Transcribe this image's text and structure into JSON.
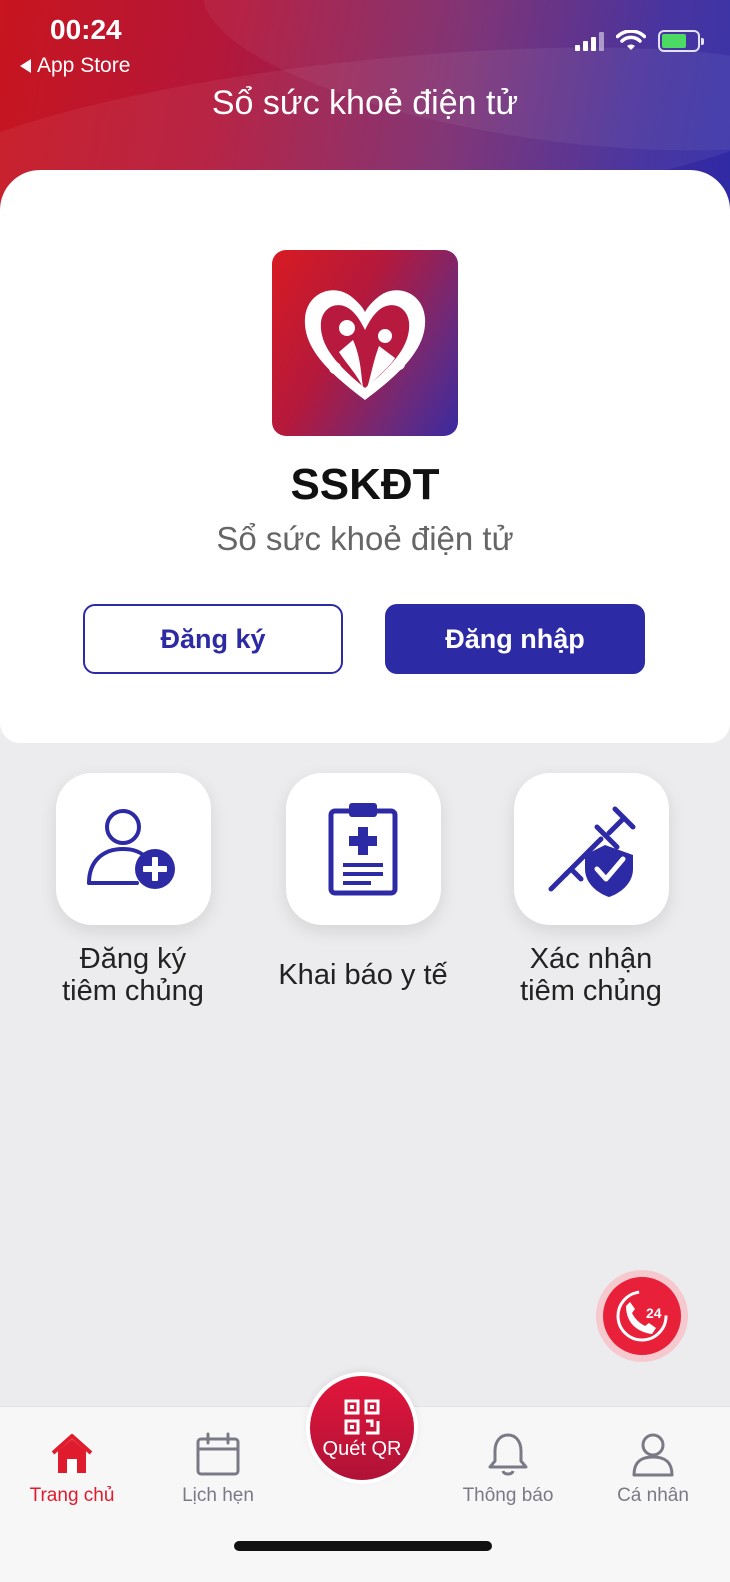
{
  "status_bar": {
    "time": "00:24",
    "back_label": "App Store"
  },
  "header": {
    "title": "Sổ sức khoẻ điện tử"
  },
  "app": {
    "name": "SSKĐT",
    "subtitle": "Sổ sức khoẻ điện tử"
  },
  "auth": {
    "register_label": "Đăng ký",
    "login_label": "Đăng nhập"
  },
  "features": [
    {
      "line1": "Đăng ký",
      "line2": "tiêm chủng",
      "icon": "add-user-icon"
    },
    {
      "line1": "Khai báo y tế",
      "line2": "",
      "icon": "medical-clipboard-icon"
    },
    {
      "line1": "Xác nhận",
      "line2": "tiêm chủng",
      "icon": "vaccine-shield-icon"
    }
  ],
  "hotline": {
    "badge": "24",
    "icon": "phone-24-icon"
  },
  "tabbar": {
    "home": "Trang chủ",
    "appointments": "Lịch hẹn",
    "scan": "Quét QR",
    "notifications": "Thông báo",
    "profile": "Cá nhân"
  },
  "colors": {
    "primary": "#2d2aa5",
    "accent_red": "#e01b2e",
    "header_start": "#c8151f",
    "header_end": "#2d2aa8"
  }
}
